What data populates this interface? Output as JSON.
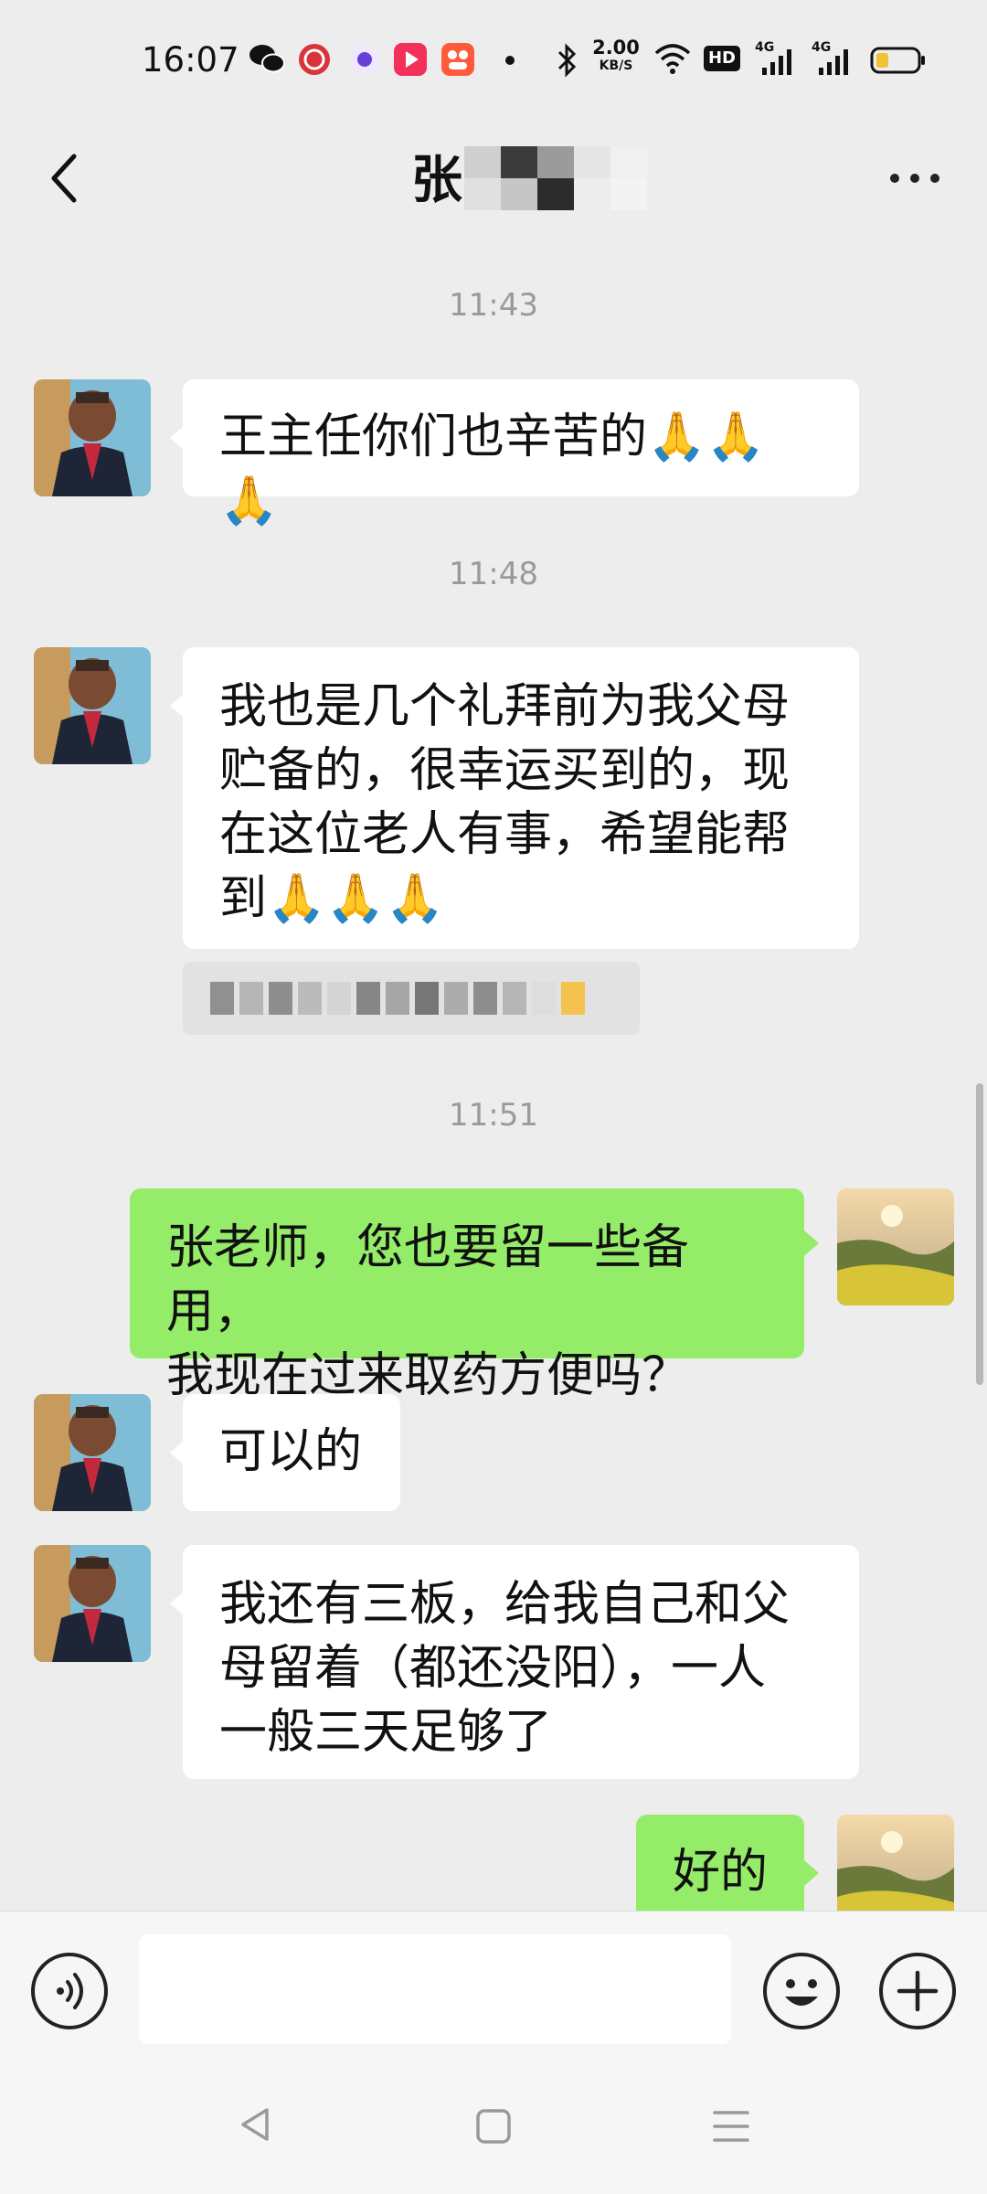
{
  "status_bar": {
    "time": "16:07",
    "network_speed_value": "2.00",
    "network_speed_unit": "KB/S",
    "hd_label": "HD",
    "signal_1": "4G",
    "signal_2": "4G",
    "icons": [
      "wechat-icon",
      "app-icon",
      "app-icon",
      "video-icon",
      "app-icon",
      "dot-icon",
      "bluetooth-icon",
      "wifi-icon",
      "battery-icon"
    ]
  },
  "header": {
    "title": "张",
    "back_icon": "chevron-left-icon",
    "more_icon": "more-dots-icon"
  },
  "messages": [
    {
      "type": "time",
      "text": "11:43"
    },
    {
      "type": "in",
      "text": "王主任你们也辛苦的🙏🙏🙏"
    },
    {
      "type": "time",
      "text": "11:48"
    },
    {
      "type": "in",
      "text": "我也是几个礼拜前为我父母\n贮备的，很幸运买到的，现\n在这位老人有事，希望能帮\n到🙏🙏🙏"
    },
    {
      "type": "quote",
      "text": ""
    },
    {
      "type": "time",
      "text": "11:51"
    },
    {
      "type": "out",
      "text": "张老师，您也要留一些备用，\n我现在过来取药方便吗？"
    },
    {
      "type": "in",
      "text": "可以的"
    },
    {
      "type": "in",
      "text": "我还有三板，给我自己和父\n母留着（都还没阳），一人\n一般三天足够了"
    },
    {
      "type": "out",
      "text": "好的"
    }
  ],
  "input_bar": {
    "voice_icon": "voice-icon",
    "emoji_icon": "emoji-icon",
    "plus_icon": "plus-icon"
  },
  "nav_bar": {
    "icons": [
      "back-triangle-icon",
      "home-square-icon",
      "menu-lines-icon"
    ]
  },
  "colors": {
    "background": "#ededed",
    "incoming_bubble": "#ffffff",
    "outgoing_bubble": "#95ec69",
    "timestamp": "#9a9a9a"
  }
}
